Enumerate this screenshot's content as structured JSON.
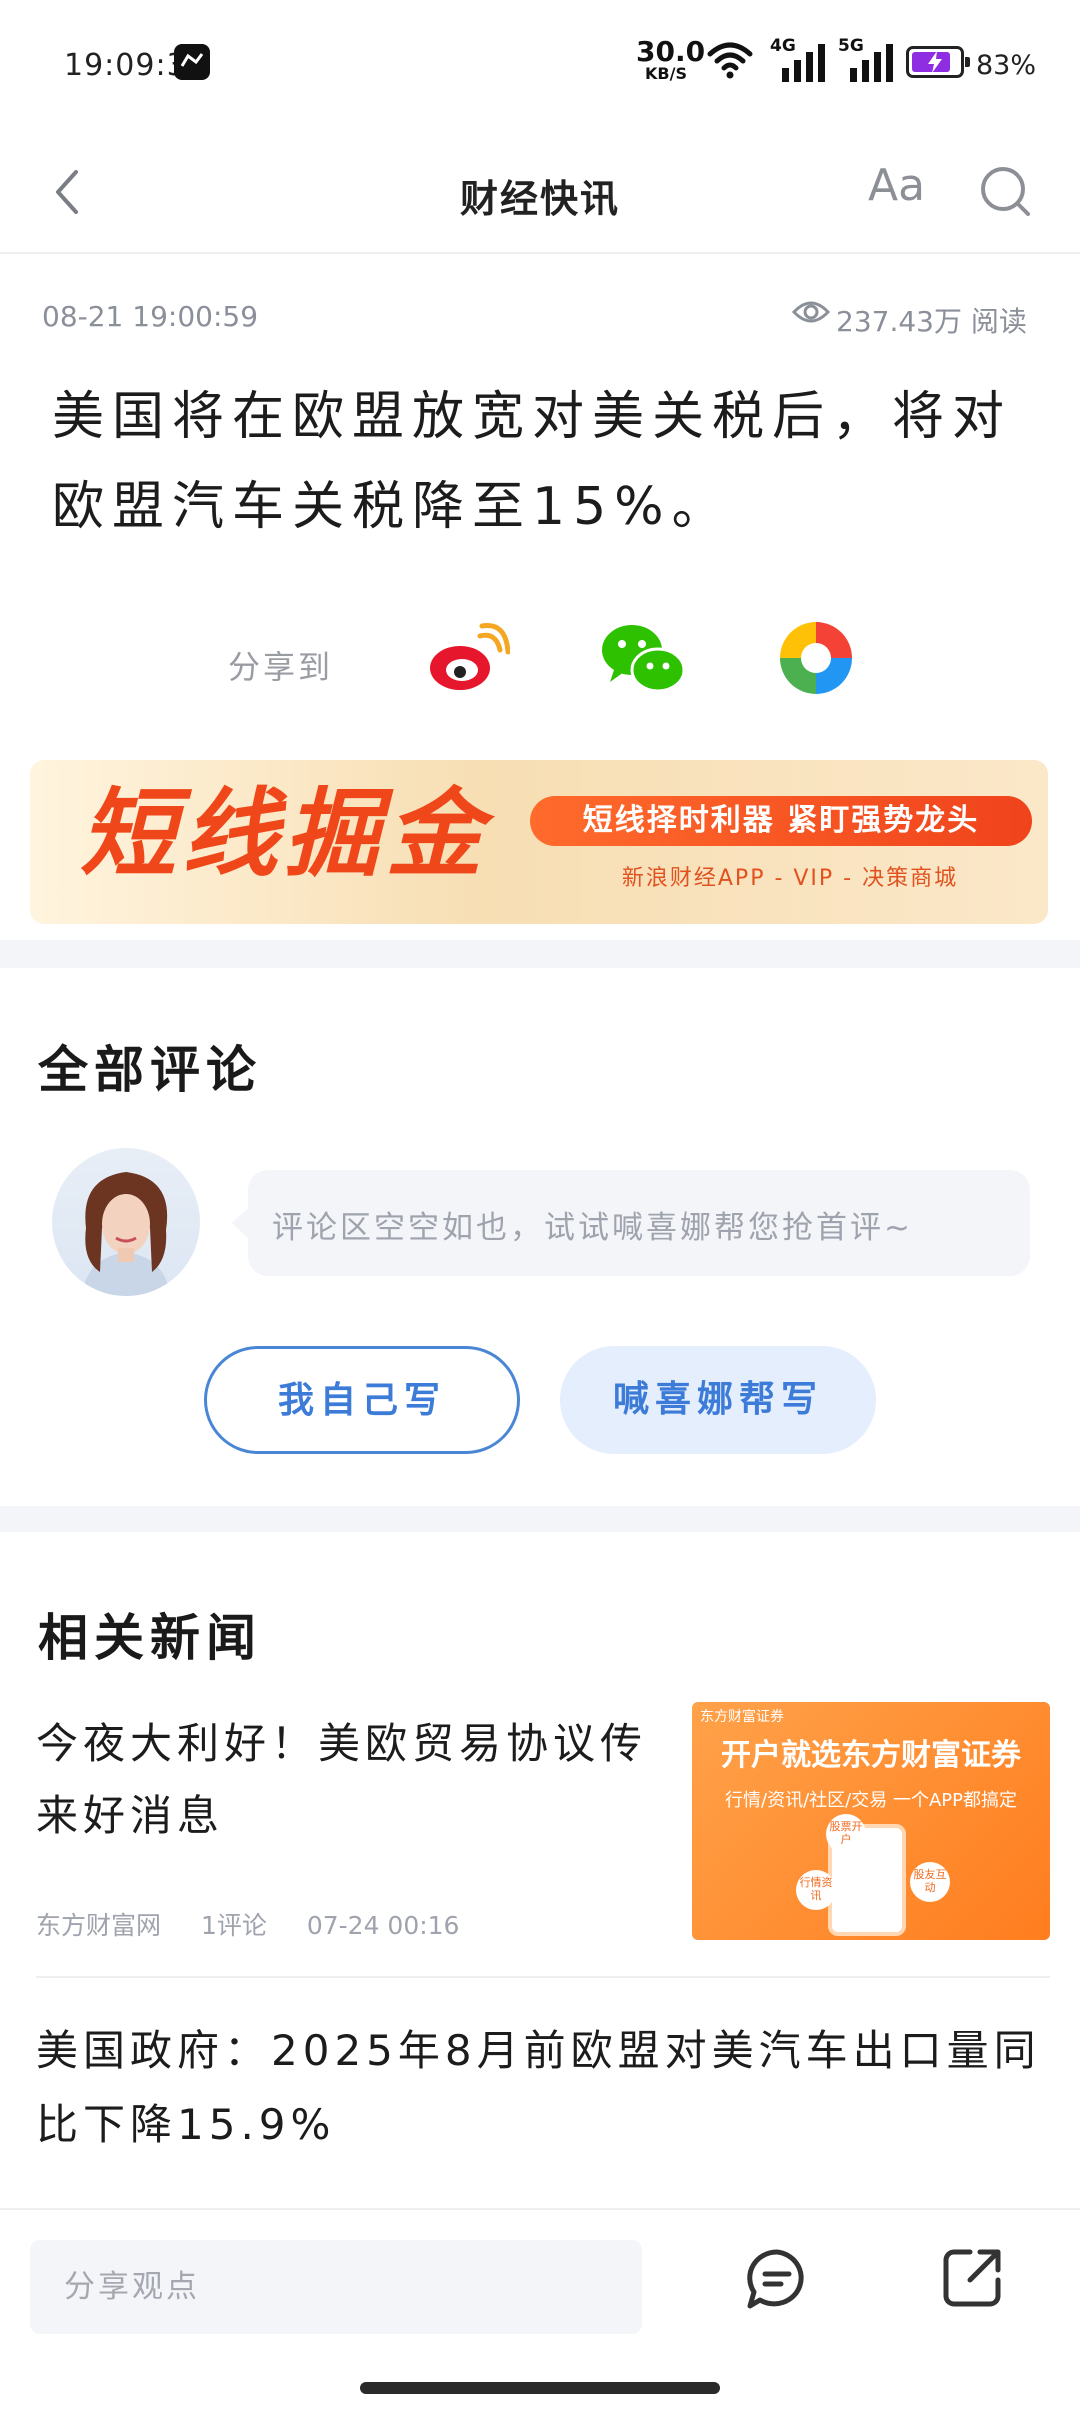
{
  "status_bar": {
    "time": "19:09:37",
    "net_speed_value": "30.0",
    "net_speed_unit": "KB/S",
    "signal_1": "4G",
    "signal_2": "5G",
    "battery": "83%",
    "battery_level": 0.83,
    "icons": [
      "app-notification-icon",
      "wifi-icon",
      "signal-4g-icon",
      "signal-5g-icon",
      "battery-charging-icon"
    ]
  },
  "nav": {
    "title": "财经快讯",
    "font_button": "Aa",
    "icons": [
      "back-icon",
      "search-icon"
    ]
  },
  "article": {
    "date": "08-21 19:00:59",
    "reads": "237.43万 阅读",
    "headline": "美国将在欧盟放宽对美关税后，将对欧盟汽车关税降至15%。",
    "share_label": "分享到",
    "share_targets": [
      "weibo-icon",
      "wechat-icon",
      "moments-icon"
    ]
  },
  "banner": {
    "headline": "短线掘金",
    "slogan": "短线择时利器 紧盯强势龙头",
    "sub": "新浪财经APP - VIP - 决策商城"
  },
  "comments": {
    "title": "全部评论",
    "empty_prompt": "评论区空空如也，试试喊喜娜帮您抢首评~",
    "write_self": "我自己写",
    "ai_write": "喊喜娜帮写"
  },
  "related": {
    "title": "相关新闻",
    "items": [
      {
        "title": "今夜大利好！美欧贸易协议传来好消息",
        "source": "东方财富网",
        "comments": "1评论",
        "time": "07-24 00:16",
        "thumb": {
          "brand": "东方财富证券",
          "headline": "开户就选东方财富证券",
          "sub": "行情/资讯/社区/交易 一个APP都搞定",
          "bubbles": [
            "股票开户",
            "行情资讯",
            "股友互动"
          ]
        }
      },
      {
        "title": "美国政府：2025年8月前欧盟对美汽车出口量同比下降15.9%"
      }
    ]
  },
  "bottom_bar": {
    "input_placeholder": "分享观点",
    "icons": [
      "comment-icon",
      "share-out-icon"
    ]
  },
  "colors": {
    "accent_blue": "#3d7bd9",
    "banner_orange": "#f0471a",
    "muted_text": "#9fa3ad",
    "battery_purple": "#8e2de2"
  }
}
